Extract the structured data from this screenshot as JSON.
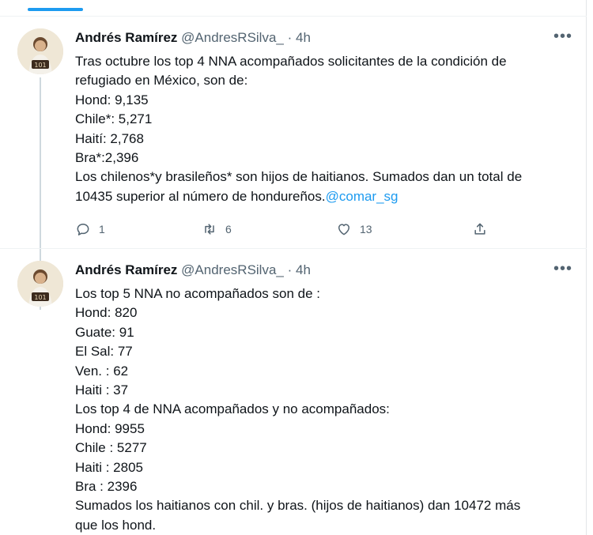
{
  "tweets": [
    {
      "author": "Andrés Ramírez",
      "handle": "@AndresRSilva_",
      "separator": "·",
      "time": "4h",
      "more": "•••",
      "lines": [
        "Tras octubre los top 4 NNA acompañados solicitantes de la condición de",
        "refugiado en México, son de:",
        "Hond: 9,135",
        "Chile*: 5,271",
        "Haití:  2,768",
        "Bra*:2,396",
        "Los chilenos*y brasileños* son hijos de haitianos. Sumados dan un total de"
      ],
      "last_line_text": "10435 superior al número de hondureños.",
      "mention": "@comar_sg",
      "actions": {
        "replies": "1",
        "retweets": "6",
        "likes": "13"
      },
      "icons": [
        "reply-icon",
        "retweet-icon",
        "like-icon",
        "share-icon"
      ]
    },
    {
      "author": "Andrés Ramírez",
      "handle": "@AndresRSilva_",
      "separator": "·",
      "time": "4h",
      "more": "•••",
      "lines": [
        "Los top 5 NNA no acompañados son de :",
        "Hond: 820",
        "Guate: 91",
        "El Sal: 77",
        "Ven.  : 62",
        "Haiti : 37",
        "Los top 4 de NNA acompañados y no acompañados:",
        "Hond: 9955",
        "Chile : 5277",
        "Haiti : 2805",
        "Bra :  2396",
        "Sumados los haitianos con chil. y bras. (hijos de haitianos) dan 10472 más",
        "que los hond."
      ]
    }
  ],
  "colors": {
    "accent": "#1d9bf0",
    "text": "#0f1419",
    "muted": "#536471"
  }
}
